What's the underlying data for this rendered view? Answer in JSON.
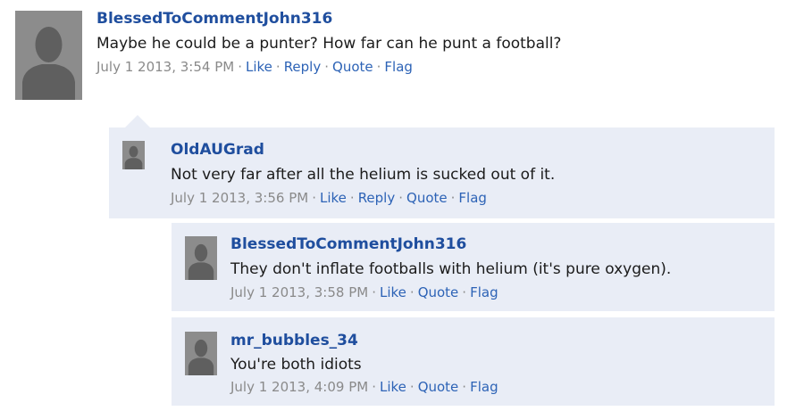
{
  "comments": [
    {
      "author": "BlessedToCommentJohn316",
      "text": "Maybe he could be a punter? How far can he punt a football?",
      "timestamp": "July 1 2013, 3:54 PM",
      "actions": [
        "Like",
        "Reply",
        "Quote",
        "Flag"
      ]
    },
    {
      "author": "OldAUGrad",
      "text": "Not very far after all the helium is sucked out of it.",
      "timestamp": "July 1 2013, 3:56 PM",
      "actions": [
        "Like",
        "Reply",
        "Quote",
        "Flag"
      ]
    },
    {
      "author": "BlessedToCommentJohn316",
      "text": "They don't inflate footballs with helium (it's pure oxygen).",
      "timestamp": "July 1 2013, 3:58 PM",
      "actions": [
        "Like",
        "Quote",
        "Flag"
      ]
    },
    {
      "author": "mr_bubbles_34",
      "text": "You're both idiots",
      "timestamp": "July 1 2013, 4:09 PM",
      "actions": [
        "Like",
        "Quote",
        "Flag"
      ]
    }
  ],
  "icons": {
    "avatar": "default-user-silhouette-icon"
  },
  "colors": {
    "author_link": "#1f4e9e",
    "action_link": "#2d63b6",
    "timestamp": "#8a8a8a",
    "reply_panel": "#e9edf6",
    "avatar_bg": "#8c8c8c"
  }
}
